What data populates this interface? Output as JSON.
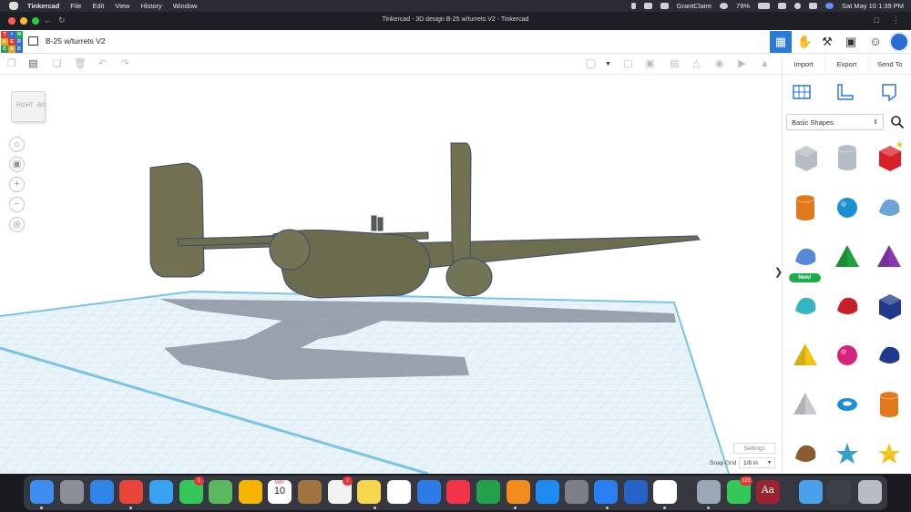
{
  "menubar": {
    "app_name": "Tinkercad",
    "menus": [
      "File",
      "Edit",
      "View",
      "History",
      "Window"
    ],
    "battery": "79%",
    "user": "GrantClaire",
    "clock": "Sat May 10  1:39 PM"
  },
  "browser": {
    "title": "Tinkercad - 3D design B-25 w/turrets V2 - Tinkercad"
  },
  "app": {
    "logo_letters": [
      "T",
      "I",
      "N",
      "K",
      "E",
      "R",
      "C",
      "A",
      "D"
    ],
    "logo_colors": [
      "#e03b30",
      "#2c6fd6",
      "#2f9e55",
      "#e8a321",
      "#e03b30",
      "#2c6fd6",
      "#2f9e55",
      "#e8a321",
      "#2c6fd6"
    ],
    "design_name": "B-25 w/turrets V2",
    "accent": "#2c7ad6"
  },
  "actions": {
    "import_label": "Import",
    "export_label": "Export",
    "sendto_label": "Send To"
  },
  "viewport": {
    "viewcube_right": "RIGHT",
    "viewcube_back": "BO",
    "settings_label": "Settings",
    "snap_grid_label": "Snap Grid",
    "snap_grid_value": "1/8 in"
  },
  "panel": {
    "library": "Basic Shapes",
    "new_badge": "New!",
    "shapes": [
      {
        "name": "box-hole",
        "color": "#b6bcc6"
      },
      {
        "name": "cylinder-hole",
        "color": "#b6bcc6"
      },
      {
        "name": "box",
        "color": "#d8202a"
      },
      {
        "name": "cylinder",
        "color": "#e0781c"
      },
      {
        "name": "sphere",
        "color": "#1b8fd1"
      },
      {
        "name": "scribble",
        "color": "#6ea3d8"
      },
      {
        "name": "shape-generator",
        "color": "#5a88d8"
      },
      {
        "name": "roof",
        "color": "#22a040"
      },
      {
        "name": "cone",
        "color": "#8a3ab0"
      },
      {
        "name": "round-roof",
        "color": "#38b3c2"
      },
      {
        "name": "text",
        "color": "#c8202a"
      },
      {
        "name": "wedge",
        "color": "#1f3a8a"
      },
      {
        "name": "pyramid",
        "color": "#f2c41c"
      },
      {
        "name": "half-sphere",
        "color": "#d6237a"
      },
      {
        "name": "polygon",
        "color": "#1f3a8a"
      },
      {
        "name": "paraboloid",
        "color": "#c9cbcf"
      },
      {
        "name": "torus",
        "color": "#1b8fd1"
      },
      {
        "name": "tube",
        "color": "#e0781c"
      },
      {
        "name": "rock",
        "color": "#8a5a32"
      },
      {
        "name": "star",
        "color": "#3aa0c8"
      },
      {
        "name": "star-yellow",
        "color": "#f2c41c"
      }
    ]
  },
  "dock": {
    "badges": {
      "calendar_month": "MAY",
      "calendar_day": "10",
      "facetime": "1",
      "reminders": "1",
      "messages": "122"
    },
    "dictionary_label": "Aa"
  }
}
